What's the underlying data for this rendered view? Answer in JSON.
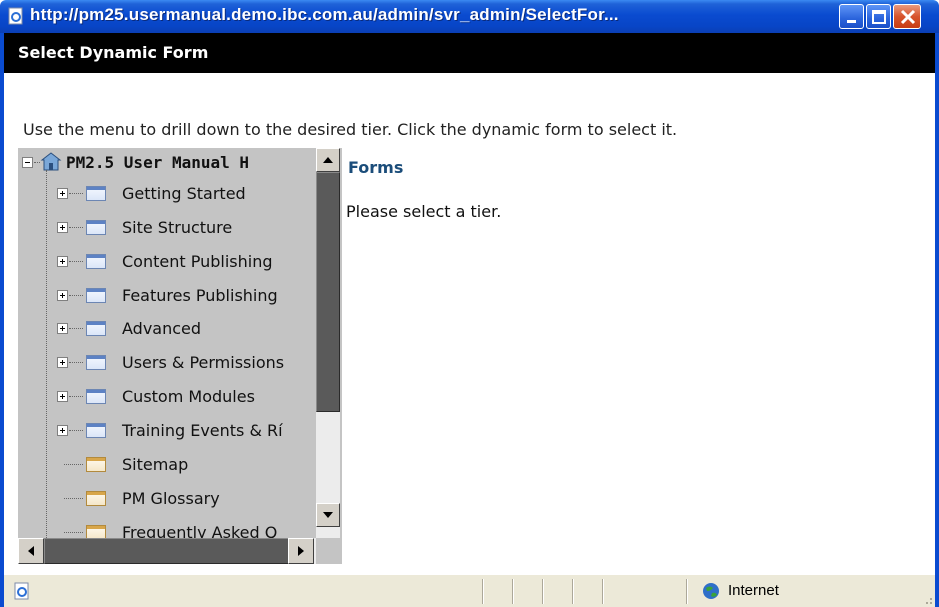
{
  "window": {
    "title": "http://pm25.usermanual.demo.ibc.com.au/admin/svr_admin/SelectFor..."
  },
  "dialog": {
    "header": "Select Dynamic Form",
    "instructions": "Use the menu to drill down to the desired tier. Click the dynamic form to select it."
  },
  "tree": {
    "root_label": "PM2.5 User Manual H",
    "items": [
      {
        "label": "Getting Started",
        "icon": "folder-icon",
        "expandable": true
      },
      {
        "label": "Site Structure",
        "icon": "folder-icon",
        "expandable": true
      },
      {
        "label": "Content Publishing",
        "icon": "folder-icon",
        "expandable": true
      },
      {
        "label": "Features Publishing",
        "icon": "folder-icon",
        "expandable": true
      },
      {
        "label": "Advanced",
        "icon": "folder-icon",
        "expandable": true
      },
      {
        "label": "Users & Permissions",
        "icon": "folder-icon",
        "expandable": true
      },
      {
        "label": "Custom Modules",
        "icon": "folder-icon",
        "expandable": true
      },
      {
        "label": "Training Events & Rí",
        "icon": "folder-icon",
        "expandable": true
      },
      {
        "label": "Sitemap",
        "icon": "page-icon",
        "expandable": false
      },
      {
        "label": "PM Glossary",
        "icon": "page-icon",
        "expandable": false
      },
      {
        "label": "Frequently Asked Q",
        "icon": "page-icon",
        "expandable": false
      }
    ]
  },
  "content": {
    "title": "Forms",
    "message": "Please select a tier."
  },
  "statusbar": {
    "zone": "Internet"
  },
  "colors": {
    "titlebar": "#0a4bd0",
    "header_bg": "#000000",
    "tree_bg": "#c4c4c4",
    "content_title": "#1b4d7a"
  }
}
